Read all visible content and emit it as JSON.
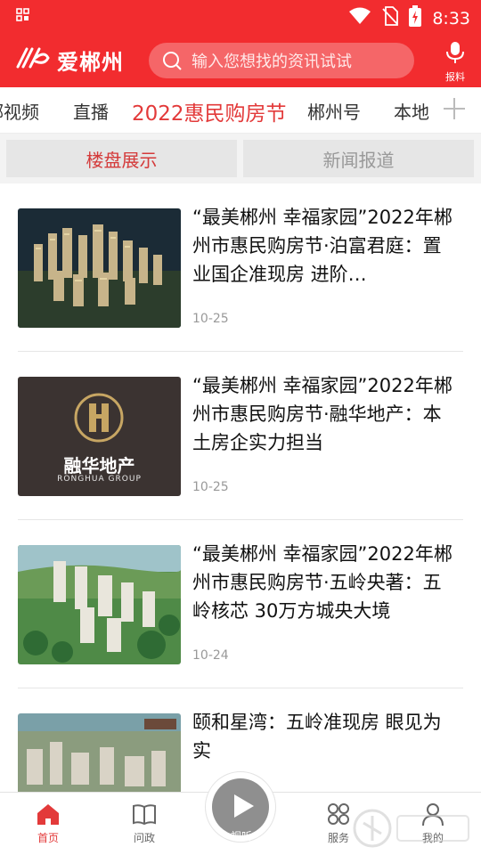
{
  "status": {
    "time": "8:33"
  },
  "header": {
    "logo_text": "爱郴州",
    "search_placeholder": "输入您想找的资讯试试",
    "report_label": "报料"
  },
  "tabs": [
    {
      "label": "郴视频"
    },
    {
      "label": "直播"
    },
    {
      "label": "2022惠民购房节",
      "active": true
    },
    {
      "label": "郴州号"
    },
    {
      "label": "本地"
    }
  ],
  "subtabs": {
    "left": "楼盘展示",
    "right": "新闻报道"
  },
  "articles": [
    {
      "title": "“最美郴州 幸福家园”2022年郴州市惠民购房节·泊富君庭：置业国企准现房 进阶…",
      "date": "10-25",
      "thumb": "night-towers"
    },
    {
      "title": "“最美郴州 幸福家园”2022年郴州市惠民购房节·融华地产：本土房企实力担当",
      "date": "10-25",
      "thumb": "ronghua-logo",
      "thumb_text": {
        "cn": "融华地产",
        "en": "RONGHUA GROUP"
      }
    },
    {
      "title": "“最美郴州 幸福家园”2022年郴州市惠民购房节·五岭央著：五岭核芯 30万方城央大境",
      "date": "10-24",
      "thumb": "aerial-green"
    },
    {
      "title": "颐和星湾：五岭准现房 眼见为实",
      "date": "",
      "thumb": "city-aerial"
    }
  ],
  "bottom_nav": {
    "home": "首页",
    "ask": "问政",
    "center": "视听",
    "service": "服务",
    "mine": "我的"
  },
  "colors": {
    "brand_red": "#f22c2f",
    "active_tab": "#e33a3a",
    "subtab_active": "#d43a3a"
  }
}
